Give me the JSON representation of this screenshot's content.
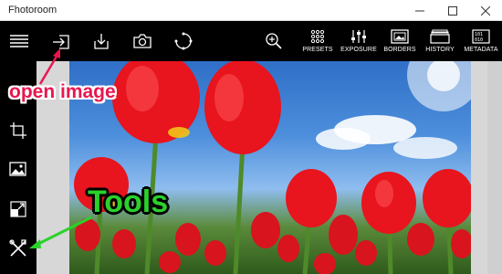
{
  "window": {
    "title": "Fhotoroom",
    "controls": [
      "minimize",
      "maximize",
      "close"
    ]
  },
  "toolbar": {
    "icons": [
      "hamburger-menu-icon",
      "open-image-icon",
      "save-download-icon",
      "camera-icon",
      "rotate-icon",
      "zoom-in-icon"
    ],
    "buttons": [
      {
        "label": "PRESETS",
        "icon": "grid-dots-icon"
      },
      {
        "label": "EXPOSURE",
        "icon": "sliders-icon"
      },
      {
        "label": "BORDERS",
        "icon": "picture-frame-icon"
      },
      {
        "label": "HISTORY",
        "icon": "stacked-layers-icon"
      },
      {
        "label": "METADATA",
        "icon": "binary-data-icon"
      }
    ]
  },
  "sidebar": {
    "icons": [
      "crop-icon",
      "image-effects-icon",
      "resize-icon",
      "tools-icon"
    ]
  },
  "annotations": {
    "open_image": "open image",
    "tools": "Tools",
    "open_image_color": "#e8174f",
    "tools_color": "#2bd12b"
  },
  "canvas": {
    "background": "#d7d7d7",
    "image": "red tulips field under blue sky"
  }
}
